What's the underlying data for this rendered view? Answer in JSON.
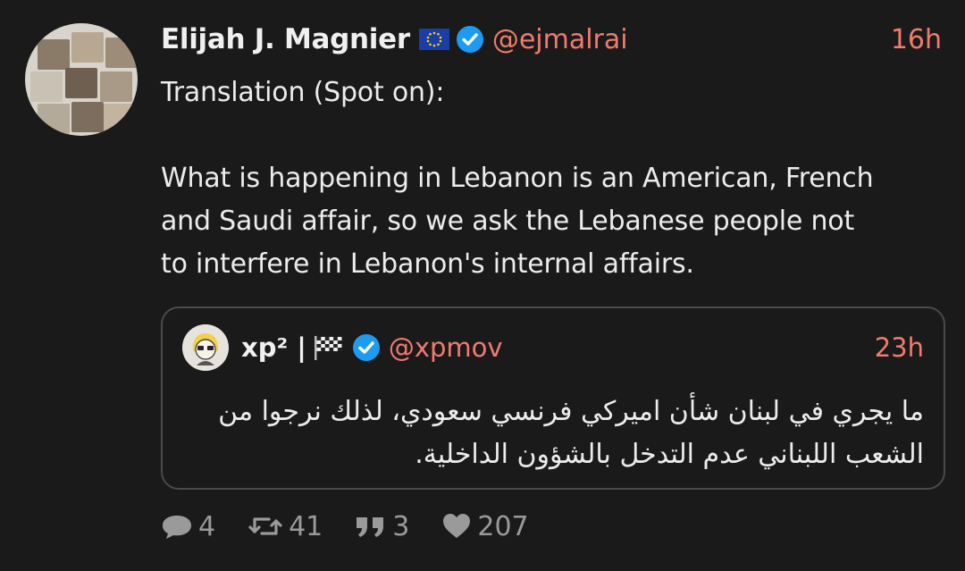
{
  "tweet": {
    "author": {
      "display_name": "Elijah J. Magnier",
      "handle": "@ejmalrai",
      "flag_icon": "eu-flag-icon",
      "verified": true
    },
    "time": "16h",
    "text_lines": [
      "Translation (Spot on):",
      "",
      "What is happening in Lebanon is an American, French",
      "and Saudi affair, so we ask the Lebanese people not",
      "to interfere in Lebanon's internal affairs."
    ],
    "quoted": {
      "display_name": "xp² |",
      "flag_icon": "checkered-flag-icon",
      "handle": "@xpmov",
      "verified": true,
      "time": "23h",
      "text_lines": [
        "ما يجري في لبنان شأن اميركي فرنسي سعودي، لذلك نرجوا من",
        "الشعب اللبناني عدم التدخل بالشؤون الداخلية."
      ]
    },
    "stats": {
      "replies": "4",
      "retweets": "41",
      "quotes": "3",
      "likes": "207"
    }
  },
  "colors": {
    "background": "#1a1a1a",
    "accent": "#f07b6e",
    "verified": "#1d9bf0",
    "muted": "#9a9a9a"
  }
}
